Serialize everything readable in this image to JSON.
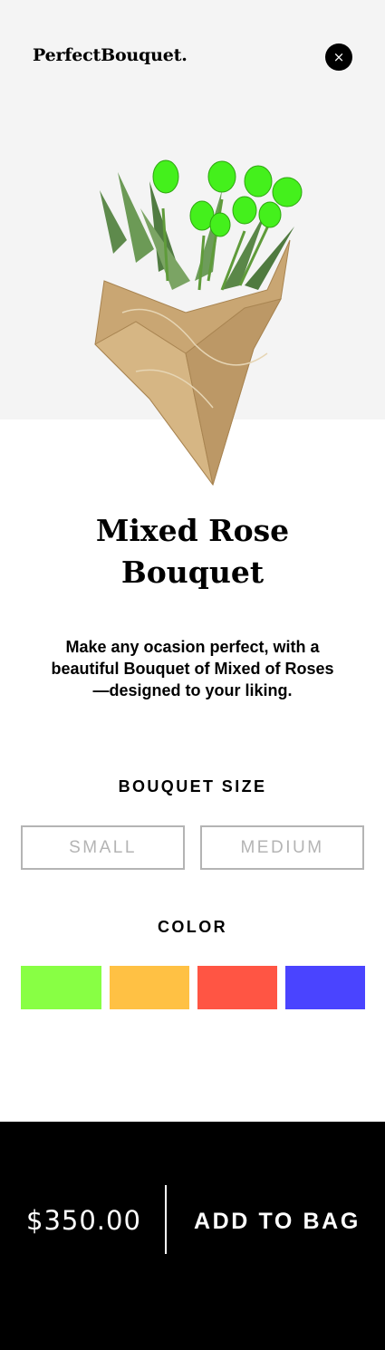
{
  "header": {
    "brand": "PerfectBouquet.",
    "close_icon": "×"
  },
  "product": {
    "title_line1": "Mixed Rose",
    "title_line2": "Bouquet",
    "description": "Make any ocasion perfect, with a beautiful Bouquet of Mixed of Roses—designed to your liking.",
    "image": "bouquet-of-green-tulips-in-kraft-paper"
  },
  "options": {
    "size_label": "BOUQUET SIZE",
    "sizes": [
      "SMALL",
      "MEDIUM"
    ],
    "color_label": "COLOR",
    "colors": [
      "#88ff44",
      "#ffc144",
      "#ff5544",
      "#4a44ff"
    ]
  },
  "footer": {
    "price": "$350.00",
    "add_label": "ADD TO BAG"
  }
}
